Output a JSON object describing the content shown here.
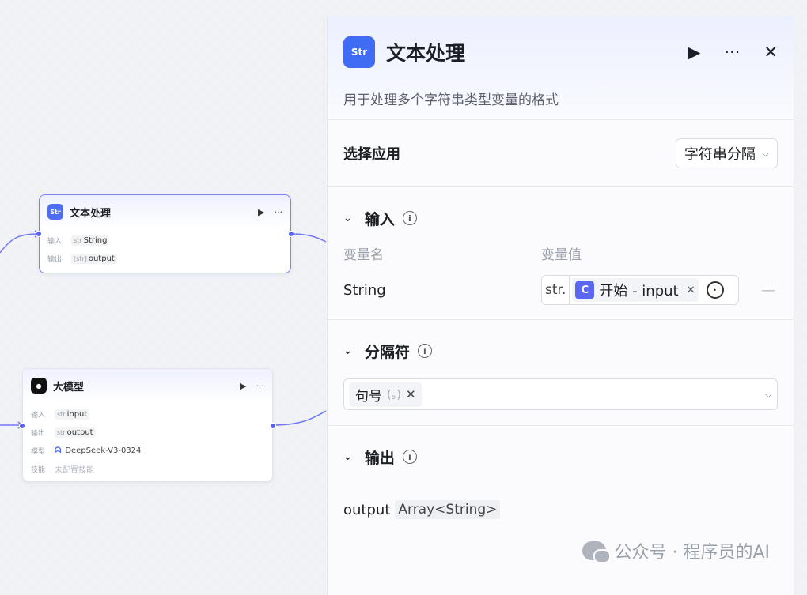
{
  "canvas": {
    "text_node": {
      "title": "文本处理",
      "rows": [
        {
          "label": "输入",
          "type": "str",
          "value": "String"
        },
        {
          "label": "输出",
          "type": "[str]",
          "value": "output"
        }
      ]
    },
    "llm_node": {
      "title": "大模型",
      "rows": [
        {
          "label": "输入",
          "type": "str",
          "value": "input"
        },
        {
          "label": "输出",
          "type": "str",
          "value": "output"
        },
        {
          "label": "模型",
          "value": "DeepSeek-V3-0324"
        },
        {
          "label": "技能",
          "value": "未配置技能"
        }
      ]
    }
  },
  "panel": {
    "icon_text": "Str",
    "title": "文本处理",
    "description": "用于处理多个字符串类型变量的格式",
    "select_app_label": "选择应用",
    "select_app_value": "字符串分隔",
    "input_section": {
      "title": "输入",
      "col_name": "变量名",
      "col_value": "变量值",
      "row": {
        "name": "String",
        "type": "str.",
        "ref": "开始 - input"
      }
    },
    "delimiter_section": {
      "title": "分隔符",
      "chip_label": "句号",
      "chip_sub": "(。)"
    },
    "output_section": {
      "title": "输出",
      "name": "output",
      "type": "Array<String>"
    }
  },
  "watermark": "公众号 · 程序员的AI",
  "colors": {
    "accent": "#5a63f0",
    "node_icon": "#4e6ef2"
  }
}
